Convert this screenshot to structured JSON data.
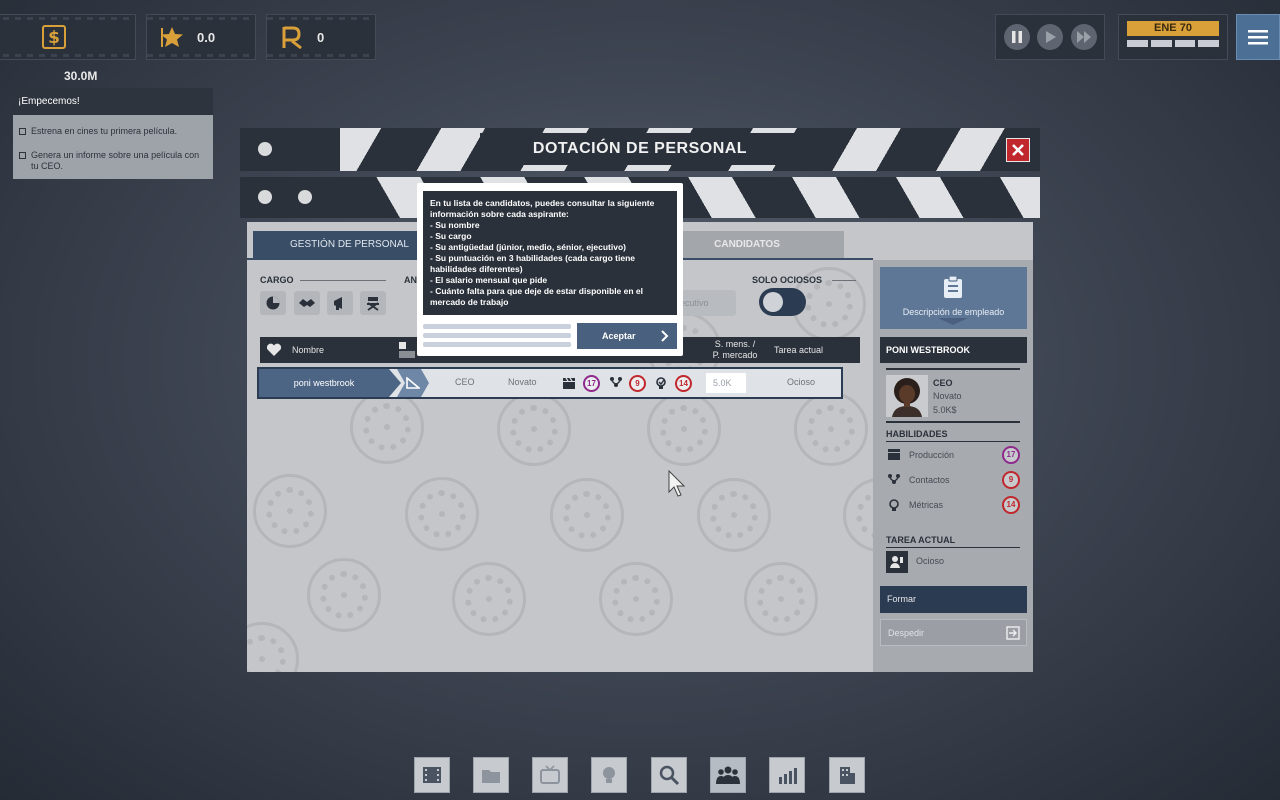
{
  "hud": {
    "money_value": "30.0M",
    "rating_value": "0.0",
    "research_value": "0",
    "date_label": "ENE 70"
  },
  "quests": {
    "title": "¡Empecemos!",
    "items": [
      {
        "label": "Estrena en cines tu primera película."
      },
      {
        "label": "Genera un informe sobre una película con tu CEO."
      }
    ]
  },
  "window": {
    "title": "DOTACIÓN DE PERSONAL",
    "tabs": [
      {
        "label": "GESTIÓN DE PERSONAL",
        "active": true
      },
      {
        "label": "CANDIDATOS",
        "active": false
      }
    ],
    "filters": {
      "cargo_label": "CARGO",
      "antiguedad_label_partial": "AN",
      "seniority_partial": "ecutivo",
      "solo_ociosos_label": "SOLO OCIOSOS"
    },
    "table": {
      "col_name": "Nombre",
      "col_salary_line1": "S. mens. /",
      "col_salary_line2": "P. mercado",
      "col_task": "Tarea actual",
      "rows": [
        {
          "name": "poni westbrook",
          "role": "CEO",
          "seniority": "Novato",
          "skill_production": "17",
          "skill_contacts": "9",
          "skill_metrics": "14",
          "salary": "5.0K",
          "task": "Ocioso"
        }
      ]
    }
  },
  "employee_panel": {
    "desc_button": "Descripción de empleado",
    "name": "PONI WESTBROOK",
    "role": "CEO",
    "seniority": "Novato",
    "salary": "5.0K$",
    "skills_title": "HABILIDADES",
    "skills": [
      {
        "label": "Producción",
        "value": "17",
        "color": "#8e2a8c"
      },
      {
        "label": "Contactos",
        "value": "9",
        "color": "#c0282d"
      },
      {
        "label": "Métricas",
        "value": "14",
        "color": "#c0282d"
      }
    ],
    "task_title": "TAREA ACTUAL",
    "task": "Ocioso",
    "train_button": "Formar",
    "fire_button": "Despedir"
  },
  "tooltip": {
    "lines": [
      "En tu lista de candidatos, puedes consultar la siguiente",
      "información sobre cada aspirante:",
      "- Su nombre",
      "- Su cargo",
      "- Su antigüedad (júnior, medio, sénior, ejecutivo)",
      "- Su puntuación en 3 habilidades (cada cargo tiene",
      "habilidades diferentes)",
      "- El salario mensual que pide",
      "- Cuánto falta para que deje de estar disponible en el",
      "mercado de trabajo"
    ],
    "accept_button": "Aceptar"
  },
  "colors": {
    "accent_gold": "#d9a03a",
    "panel_dark": "#2b313b",
    "close_red": "#c0282d",
    "skill_purple": "#8e2a8c",
    "skill_red": "#c0282d"
  }
}
